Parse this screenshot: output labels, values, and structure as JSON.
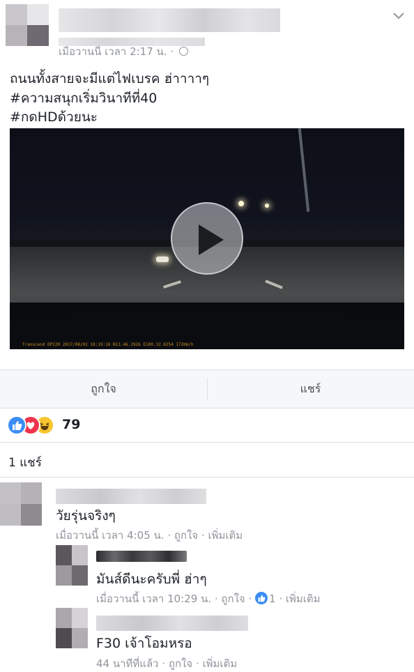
{
  "post": {
    "meta": "เมื่อวานนี้ เวลา 2:17 น. ·",
    "lines": [
      "ถนนทั้งสายจะมีแต่ไฟเบรค ฮ่าาาาๆ",
      "#ความสนุกเริ่มวินาทีที่40",
      "#กดHDด้วยนะ"
    ],
    "video_overlay": "Transcend DP220 2017/08/02 18:19:16   N13.46.2926  E100.32.8254 172Km/h"
  },
  "actions": {
    "like_label": "ถูกใจ",
    "share_label": "แชร์"
  },
  "reactions": {
    "count": "79",
    "types": [
      "like-icon",
      "love-icon",
      "haha-icon"
    ]
  },
  "shares_label": "1 แชร์",
  "comments": [
    {
      "text": "วัยรุ่นจริงๆ",
      "meta": "เมื่อวานนี้ เวลา 4:05 น. · ถูกใจ · เพิ่มเติม"
    },
    {
      "text": "มันส์ดีนะครับพี่ ฮ่าๆ",
      "meta_prefix": "เมื่อวานนี้ เวลา 10:29 น. · ถูกใจ ·",
      "like_count": "1",
      "meta_suffix": "· เพิ่มเติม"
    },
    {
      "text": "F30 เจ้าโอมหรอ",
      "meta": "44 นาทีที่แล้ว · ถูกใจ · เพิ่มเติม"
    }
  ],
  "colors": {
    "like_blue": "#3b8df5",
    "love_red": "#f0344c",
    "haha_yellow": "#f7c531",
    "meta_gray": "#90949c"
  }
}
